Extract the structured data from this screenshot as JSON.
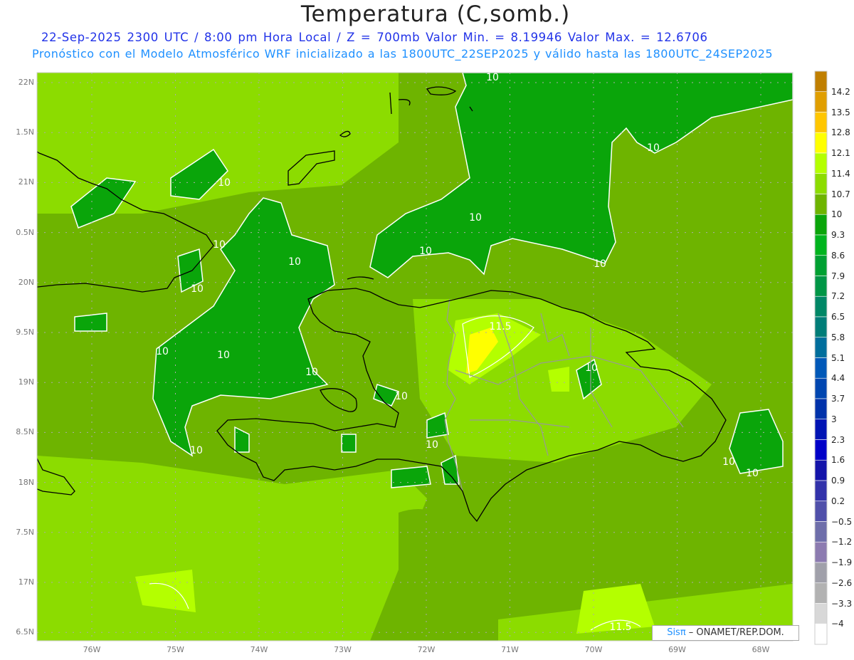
{
  "header": {
    "title": "Temperatura (C,somb.)",
    "line1": "22-Sep-2025  2300 UTC / 8:00 pm Hora Local / Z = 700mb    Valor Min. = 8.19946  Valor Max. = 12.6706",
    "line2": "Pronóstico con el Modelo Atmosférico WRF inicializado a las 1800UTC_22SEP2025 y válido hasta las  1800UTC_24SEP2025"
  },
  "axes": {
    "lat_labels": [
      "22N",
      "1.5N",
      "21N",
      "0.5N",
      "20N",
      "9.5N",
      "19N",
      "8.5N",
      "18N",
      "7.5N",
      "17N",
      "6.5N"
    ],
    "lon_labels": [
      "76W",
      "75W",
      "74W",
      "73W",
      "72W",
      "71W",
      "70W",
      "69W",
      "68W"
    ]
  },
  "colorbar": {
    "labels": [
      "14.2",
      "13.5",
      "12.8",
      "12.1",
      "11.4",
      "10.7",
      "10",
      "9.3",
      "8.6",
      "7.9",
      "7.2",
      "6.5",
      "5.8",
      "5.1",
      "4.4",
      "3.7",
      "3",
      "2.3",
      "1.6",
      "0.9",
      "0.2",
      "−0.5",
      "−1.2",
      "−1.9",
      "−2.6",
      "−3.3",
      "−4"
    ],
    "colors": [
      "#c07f00",
      "#e09e00",
      "#ffc600",
      "#ffff00",
      "#b4ff00",
      "#8cdc00",
      "#6eb400",
      "#0aa50a",
      "#00b41e",
      "#00a032",
      "#009646",
      "#008766",
      "#007d78",
      "#006e9c",
      "#0058b8",
      "#0046b0",
      "#0032aa",
      "#0014b4",
      "#0000c8",
      "#1414aa",
      "#3232aa",
      "#5050aa",
      "#6e6eaa",
      "#8c7bb0",
      "#a0a0aa",
      "#b2b2b2",
      "#d8d8d8",
      "#ffffff"
    ]
  },
  "map_colors": {
    "base": "#6eb400",
    "light": "#8cdc00",
    "lime": "#b4ff00",
    "yellow": "#ffff00",
    "green": "#0aa50a"
  },
  "contour_labels": [
    "10",
    "10",
    "10",
    "10",
    "10",
    "10",
    "10",
    "10",
    "10",
    "10",
    "10",
    "10",
    "10",
    "10",
    "10",
    "10",
    "10",
    "10",
    "11.5",
    "11.5"
  ],
  "footer": {
    "logo_sis": "Sisπ",
    "logo_text": " – ONAMET/REP.DOM."
  }
}
